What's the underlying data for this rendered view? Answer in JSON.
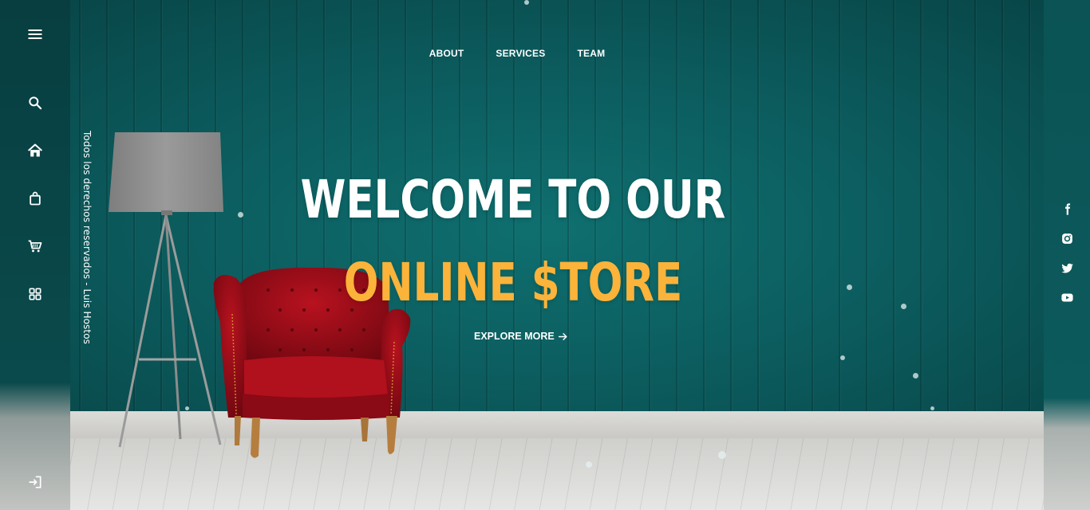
{
  "nav": {
    "items": [
      {
        "label": "ABOUT"
      },
      {
        "label": "SERVICES"
      },
      {
        "label": "TEAM"
      }
    ]
  },
  "hero": {
    "line1": "WELCOME TO OUR",
    "line2": "ONLINE $TORE",
    "cta_label": "EXPLORE MORE",
    "accent_color": "#fbb33a",
    "text_color": "#ffffff",
    "wall_color": "#0c5d5f"
  },
  "sidebar": {
    "menu_icon": "hamburger-menu-icon",
    "icons": [
      "search-icon",
      "home-icon",
      "shopping-bag-icon",
      "cart-icon",
      "grid-icon"
    ],
    "logout_icon": "login-icon",
    "vertical_text": "Todos los derechos reservados - Luis Hostos"
  },
  "social": {
    "icons": [
      "facebook-icon",
      "instagram-icon",
      "twitter-icon",
      "youtube-icon"
    ]
  },
  "scene": {
    "chair_color": "#a3101c",
    "lamp_shade_color": "#8a8a8a"
  }
}
